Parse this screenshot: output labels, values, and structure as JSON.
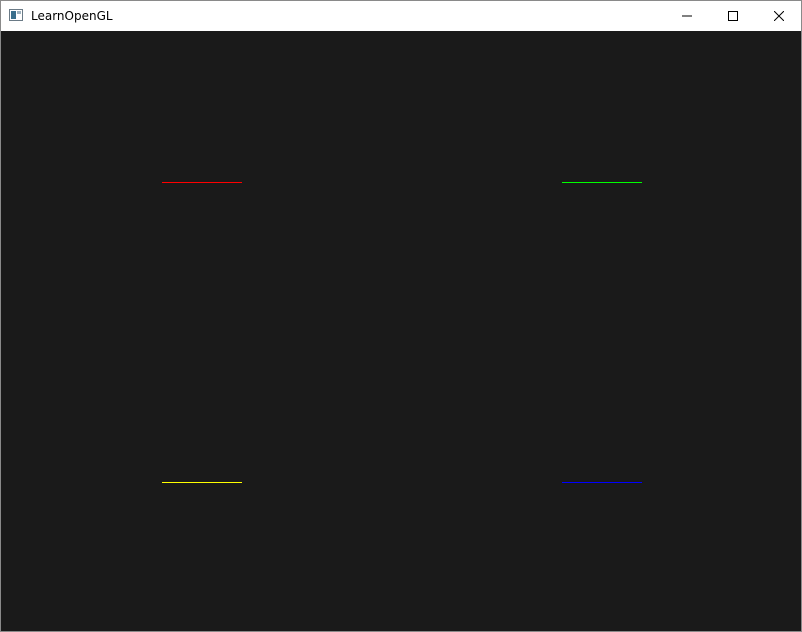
{
  "window": {
    "title": "LearnOpenGL",
    "clear_color": "#1a1a1a",
    "icons": {
      "app": "app-window-icon",
      "minimize": "minimize-icon",
      "maximize": "maximize-icon",
      "close": "close-icon"
    }
  },
  "scene": {
    "lines": [
      {
        "name": "red-line",
        "color": "#ff0000"
      },
      {
        "name": "green-line",
        "color": "#00ff00"
      },
      {
        "name": "yellow-line",
        "color": "#ffff00"
      },
      {
        "name": "blue-line",
        "color": "#0000ff"
      }
    ]
  }
}
